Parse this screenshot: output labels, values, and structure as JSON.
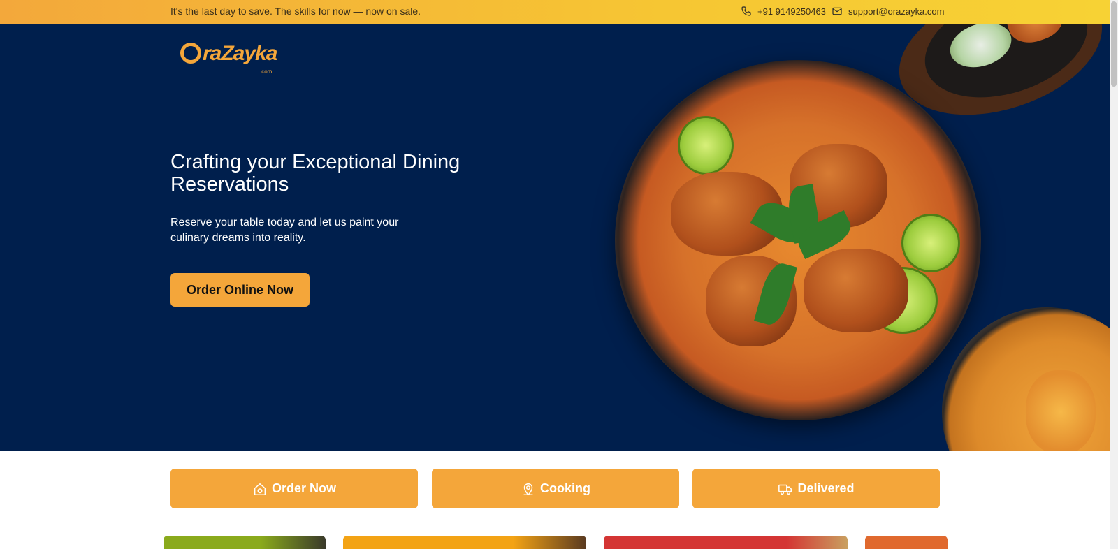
{
  "topbar": {
    "promo": "It's the last day to save. The skills for now — now on sale.",
    "phone": "+91 9149250463",
    "email": "support@orazayka.com",
    "phone_icon": "phone-icon",
    "email_icon": "mail-icon"
  },
  "brand": {
    "name": "OraZayka",
    "word": "raZayka",
    "suffix": ".com"
  },
  "hero": {
    "title": "Crafting your Exceptional Dining Reservations",
    "subtitle": "Reserve your table today and let us paint your culinary dreams into reality.",
    "cta_label": "Order Online Now",
    "background": "#001f4d"
  },
  "steps": [
    {
      "label": "Order Now",
      "icon": "house-icon"
    },
    {
      "label": "Cooking",
      "icon": "location-pin-icon"
    },
    {
      "label": "Delivered",
      "icon": "delivery-truck-icon"
    }
  ],
  "colors": {
    "accent": "#f4a63a",
    "topbar_start": "#f3a83b",
    "topbar_end": "#f7d234",
    "navy": "#001f4d"
  }
}
